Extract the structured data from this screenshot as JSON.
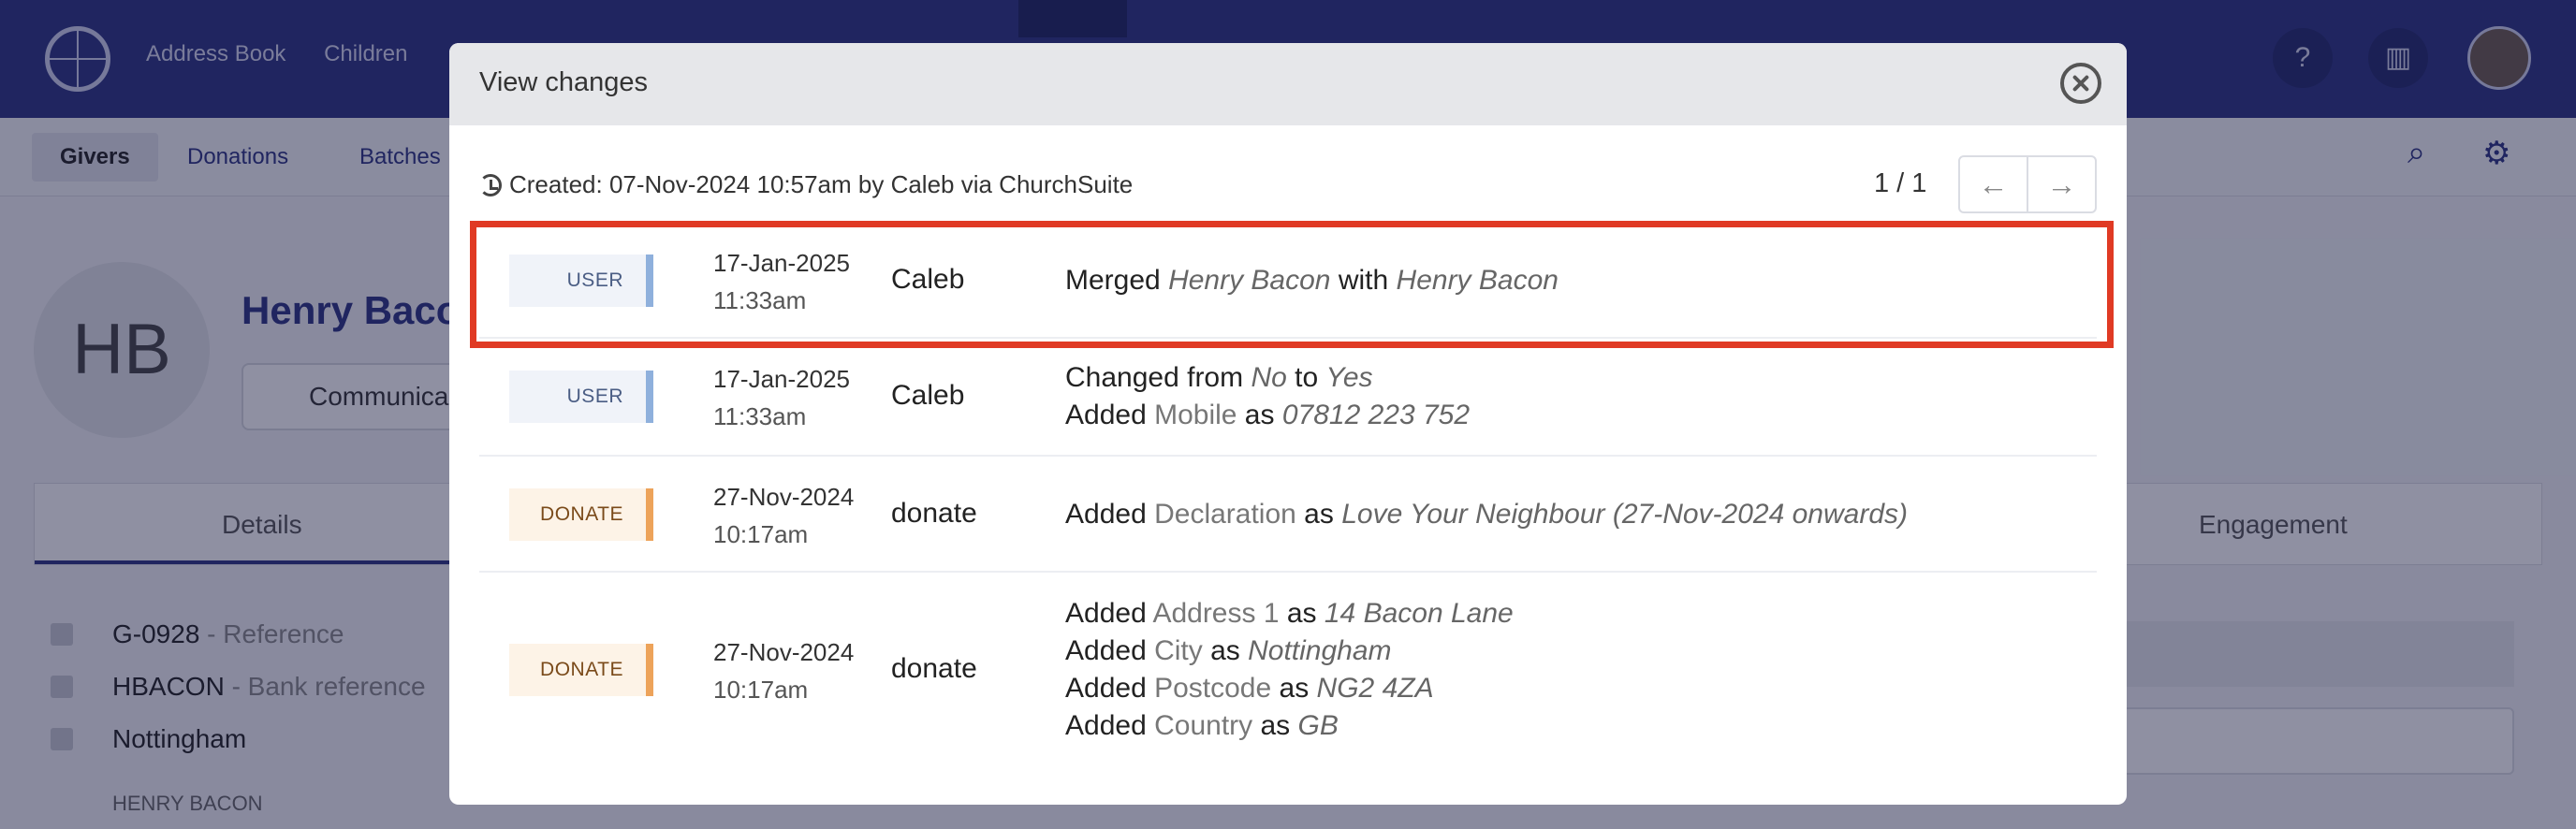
{
  "app": {
    "topnav": [
      "Address Book",
      "Children"
    ],
    "subtabs": [
      "Givers",
      "Donations",
      "Batches"
    ],
    "giver": {
      "initials": "HB",
      "name": "Henry Bacon",
      "communicate_label": "Communica",
      "tabs": [
        "Details",
        "Engagement"
      ],
      "details": [
        {
          "value": "G-0928",
          "label": " - Reference"
        },
        {
          "value": "HBACON",
          "label": " - Bank reference"
        },
        {
          "value": "Nottingham",
          "label": ""
        }
      ],
      "small_name": "HENRY BACON"
    }
  },
  "modal": {
    "title": "View changes",
    "created": "Created: 07-Nov-2024 10:57am by Caleb via ChurchSuite",
    "pager": {
      "count": "1 / 1",
      "prev": "←",
      "next": "→"
    },
    "rows": [
      {
        "badge": "USER",
        "type": "user",
        "date": "17-Jan-2025",
        "time": "11:33am",
        "who": "Caleb",
        "changes": [
          {
            "pre": "Merged ",
            "v1": "Henry Bacon",
            "mid": " with ",
            "v2": "Henry Bacon"
          }
        ]
      },
      {
        "badge": "USER",
        "type": "user",
        "date": "17-Jan-2025",
        "time": "11:33am",
        "who": "Caleb",
        "changes": [
          {
            "pre": "Changed from ",
            "v1": "No",
            "mid": " to ",
            "v2": "Yes"
          },
          {
            "pre": "Added ",
            "field": "Mobile",
            "mid": " as ",
            "v2": "07812 223 752"
          }
        ]
      },
      {
        "badge": "DONATE",
        "type": "donate",
        "date": "27-Nov-2024",
        "time": "10:17am",
        "who": "donate",
        "changes": [
          {
            "pre": "Added ",
            "field": "Declaration",
            "mid": " as ",
            "v2": "Love Your Neighbour (27-Nov-2024 onwards)"
          }
        ]
      },
      {
        "badge": "DONATE",
        "type": "donate",
        "date": "27-Nov-2024",
        "time": "10:17am",
        "who": "donate",
        "changes": [
          {
            "pre": "Added ",
            "field": "Address 1",
            "mid": " as ",
            "v2": "14 Bacon Lane"
          },
          {
            "pre": "Added ",
            "field": "City",
            "mid": " as ",
            "v2": "Nottingham"
          },
          {
            "pre": "Added ",
            "field": "Postcode",
            "mid": " as ",
            "v2": "NG2 4ZA"
          },
          {
            "pre": "Added ",
            "field": "Country",
            "mid": " as ",
            "v2": "GB"
          }
        ]
      }
    ]
  },
  "colors": {
    "accent": "#2b3381",
    "highlight": "#e03a24",
    "user_bar": "#8fb0dc",
    "donate_bar": "#eda35a"
  }
}
